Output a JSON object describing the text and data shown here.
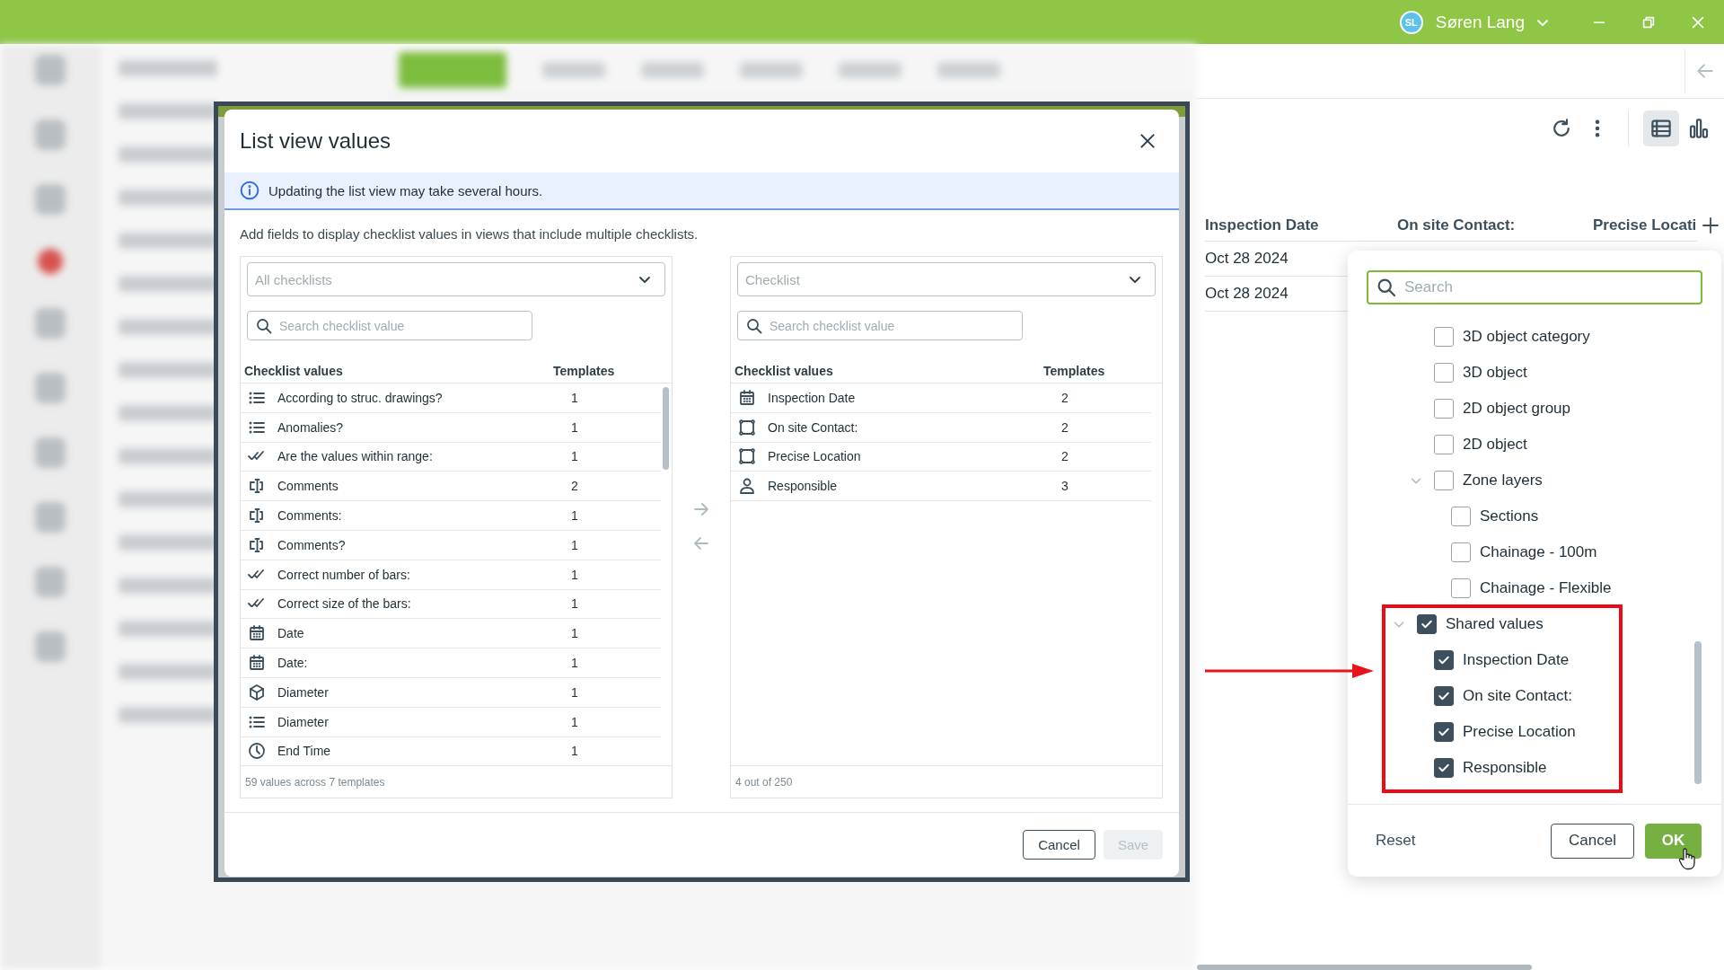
{
  "top_bar": {
    "user_initials": "SL",
    "user_name": "Søren Lang"
  },
  "dialog": {
    "title": "List view values",
    "info": "Updating the list view may take several hours.",
    "description": "Add fields to display checklist values in views that include multiple checklists.",
    "available": {
      "dropdown_placeholder": "All checklists",
      "search_placeholder": "Search checklist value",
      "columns": [
        "Checklist values",
        "Templates"
      ],
      "rows": [
        {
          "kind": "list",
          "name": "According to struc. drawings?",
          "templates": "1"
        },
        {
          "kind": "list",
          "name": "Anomalies?",
          "templates": "1"
        },
        {
          "kind": "check",
          "name": "Are the values within range:",
          "templates": "1"
        },
        {
          "kind": "text",
          "name": "Comments",
          "templates": "2"
        },
        {
          "kind": "text",
          "name": "Comments:",
          "templates": "1"
        },
        {
          "kind": "text",
          "name": "Comments?",
          "templates": "1"
        },
        {
          "kind": "check",
          "name": "Correct number of bars:",
          "templates": "1"
        },
        {
          "kind": "check",
          "name": "Correct size of the bars:",
          "templates": "1"
        },
        {
          "kind": "date",
          "name": "Date",
          "templates": "1"
        },
        {
          "kind": "date",
          "name": "Date:",
          "templates": "1"
        },
        {
          "kind": "cube",
          "name": "Diameter",
          "templates": "1"
        },
        {
          "kind": "list",
          "name": "Diameter",
          "templates": "1"
        },
        {
          "kind": "time",
          "name": "End Time",
          "templates": "1"
        }
      ],
      "footer": "59 values across 7 templates"
    },
    "chosen": {
      "dropdown_placeholder": "Checklist",
      "search_placeholder": "Search checklist value",
      "columns": [
        "Checklist values",
        "Templates"
      ],
      "rows": [
        {
          "kind": "date",
          "name": "Inspection Date",
          "templates": "2"
        },
        {
          "kind": "shape",
          "name": "On site Contact:",
          "templates": "2"
        },
        {
          "kind": "shape",
          "name": "Precise Location",
          "templates": "2"
        },
        {
          "kind": "person",
          "name": "Responsible",
          "templates": "3"
        }
      ],
      "footer": "4 out of 250"
    },
    "buttons": [
      {
        "label": "Cancel",
        "disabled": false
      },
      {
        "label": "Save",
        "disabled": true
      }
    ]
  },
  "view_toolbar": {
    "views": [
      {
        "kind": "list",
        "selected": true
      },
      {
        "kind": "chart",
        "selected": false
      }
    ]
  },
  "table": {
    "columns": [
      "Inspection Date",
      "On site Contact:",
      "Precise Locati"
    ],
    "rows": [
      {
        "cells": [
          "Oct 28 2024"
        ]
      },
      {
        "cells": [
          "Oct 28 2024"
        ]
      }
    ]
  },
  "column_picker": {
    "search_placeholder": "Search",
    "continued_items": [
      {
        "label": "3D object category",
        "checked": false
      },
      {
        "label": "3D object",
        "checked": false
      },
      {
        "label": "2D object group",
        "checked": false
      },
      {
        "label": "2D object",
        "checked": false
      },
      {
        "label": "Zone layers",
        "checked": false,
        "expanded": true,
        "children": [
          {
            "label": "Sections",
            "checked": false
          },
          {
            "label": "Chainage - 100m",
            "checked": false
          },
          {
            "label": "Chainage - Flexible",
            "checked": false
          }
        ]
      }
    ],
    "items": [
      {
        "label": "Shared values",
        "checked": true,
        "expanded": true,
        "children": [
          {
            "label": "Inspection Date",
            "checked": true
          },
          {
            "label": "On site Contact:",
            "checked": true
          },
          {
            "label": "Precise Location",
            "checked": true
          },
          {
            "label": "Responsible",
            "checked": true
          }
        ]
      }
    ],
    "reset": "Reset",
    "buttons": [
      {
        "label": "Cancel",
        "kind": "secondary"
      },
      {
        "label": "OK",
        "kind": "primary"
      }
    ]
  }
}
